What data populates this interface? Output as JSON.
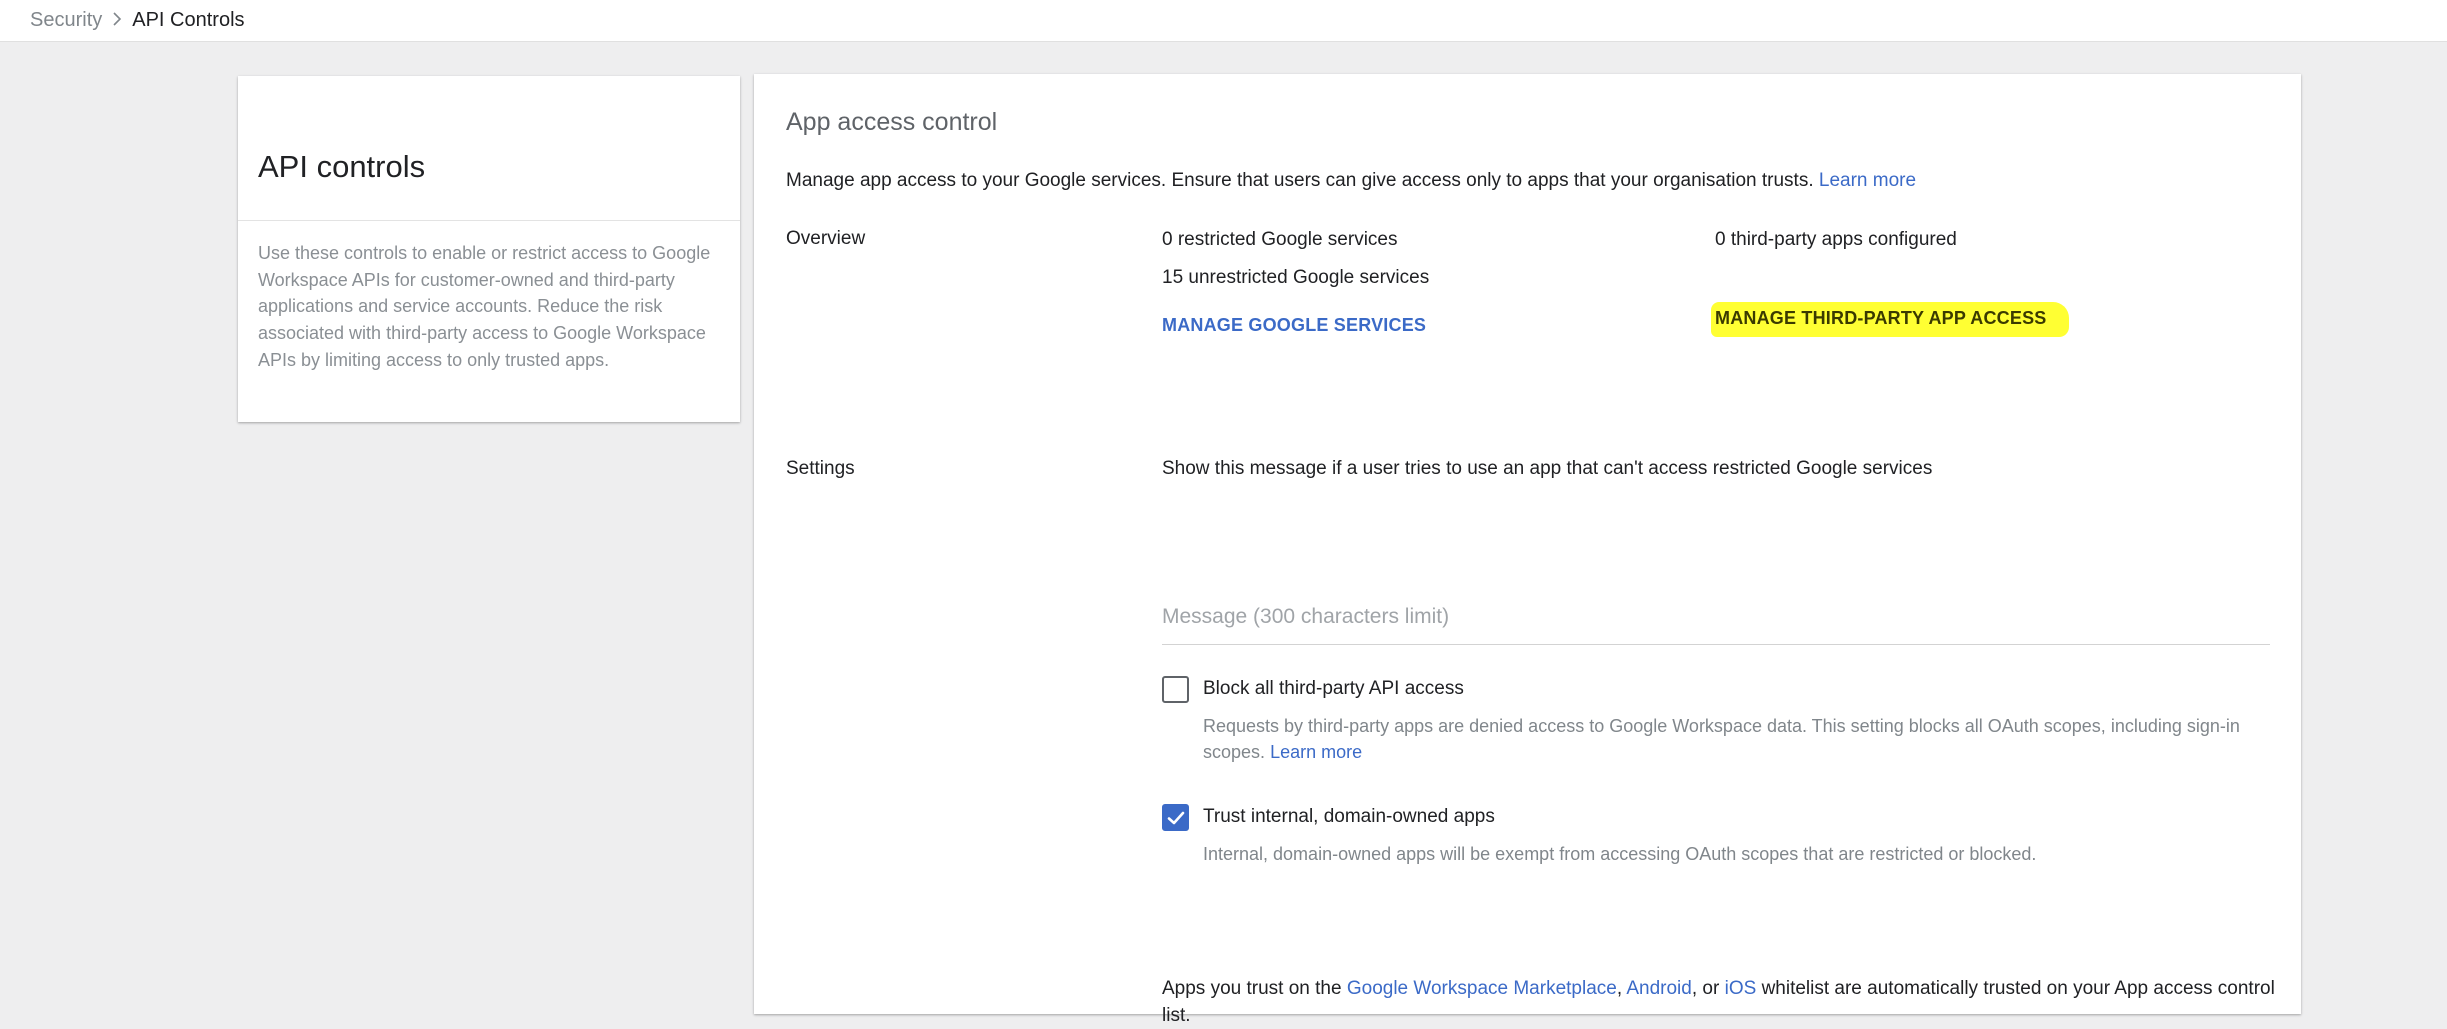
{
  "breadcrumb": {
    "parent": "Security",
    "current": "API Controls"
  },
  "left_card": {
    "title": "API controls",
    "description": "Use these controls to enable or restrict access to Google Workspace APIs for customer-owned and third-party applications and service accounts. Reduce the risk associated with third-party access to Google Workspace APIs by limiting access to only trusted apps."
  },
  "main": {
    "title": "App access control",
    "intro_text": "Manage app access to your Google services. Ensure that users can give access only to apps that your organisation trusts.",
    "intro_link": "Learn more",
    "overview": {
      "label": "Overview",
      "restricted": "0 restricted Google services",
      "unrestricted": "15 unrestricted Google services",
      "manage_services": "MANAGE GOOGLE SERVICES",
      "third_party": "0 third-party apps configured",
      "manage_third_party": "MANAGE THIRD-PARTY APP ACCESS"
    },
    "settings": {
      "label": "Settings",
      "description": "Show this message if a user tries to use an app that can't access restricted Google services",
      "message_placeholder": "Message (300 characters limit)",
      "message_value": "",
      "block_all": {
        "label": "Block all third-party API access",
        "help": "Requests by third-party apps are denied access to Google Workspace data. This setting blocks all OAuth scopes, including sign-in scopes.",
        "help_link": "Learn more",
        "checked": false
      },
      "trust_internal": {
        "label": "Trust internal, domain-owned apps",
        "help": "Internal, domain-owned apps will be exempt from accessing OAuth scopes that are restricted or blocked.",
        "checked": true
      },
      "trust_note": {
        "prefix": "Apps you trust on the",
        "marketplace": "Google Workspace Marketplace",
        "comma": ",",
        "android": "Android",
        "or": ", or",
        "ios": "iOS",
        "suffix": "whitelist are automatically trusted on your App access control list."
      }
    }
  },
  "colors": {
    "link": "#3b6ac7",
    "highlight": "#ffff33",
    "page_background": "#eeeeef"
  }
}
